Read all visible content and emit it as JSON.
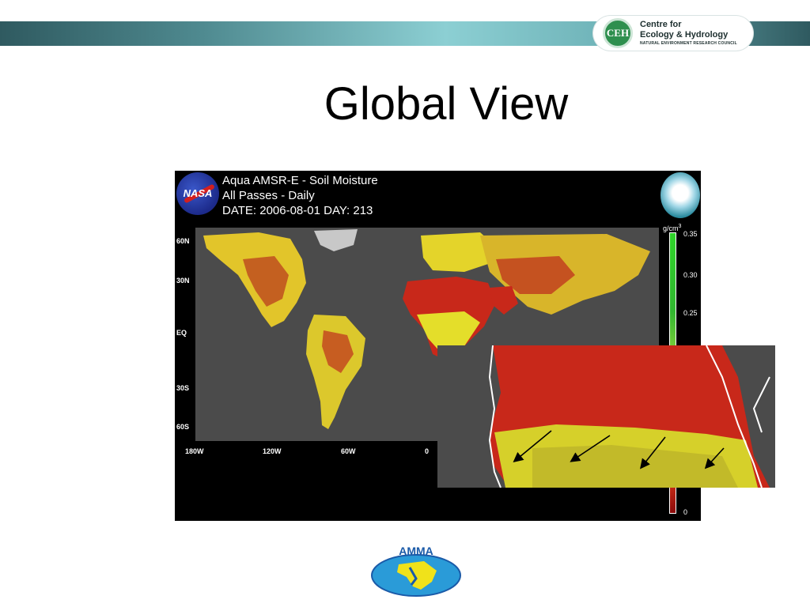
{
  "header": {
    "org_logo": {
      "monogram": "CEH",
      "line1": "Centre for",
      "line2": "Ecology & Hydrology",
      "line3": "NATURAL ENVIRONMENT RESEARCH COUNCIL"
    },
    "colors": {
      "band_dark": "#2f5a60",
      "band_light": "#8ccfd3",
      "ceh_green": "#2e8f4e"
    }
  },
  "slide": {
    "title": "Global View"
  },
  "map_panel": {
    "nasa_logo_text": "NASA",
    "title_line1": "Aqua  AMSR-E - Soil Moisture",
    "title_line2": "All Passes - Daily",
    "title_line3": "DATE: 2006-08-01  DAY: 213",
    "lat_labels": [
      "60N",
      "30N",
      "EQ",
      "30S",
      "60S"
    ],
    "lon_labels": [
      "180W",
      "120W",
      "60W",
      "0"
    ],
    "colorbar": {
      "unit": "g/cm",
      "unit_exponent": "3",
      "labels": [
        "0.35",
        "0.30",
        "0.25",
        "0"
      ],
      "colors": [
        "#2fd42a",
        "#f0ee2a",
        "#d83318",
        "#8a0a0a"
      ]
    },
    "colors": {
      "ocean": "#4b4b4b",
      "dry": "#c8281a",
      "moist": "#e4e02a",
      "ice": "#c8c8c8"
    }
  },
  "inset": {
    "arrow_count": 4
  },
  "footer_logo": {
    "text": "AMMA"
  }
}
